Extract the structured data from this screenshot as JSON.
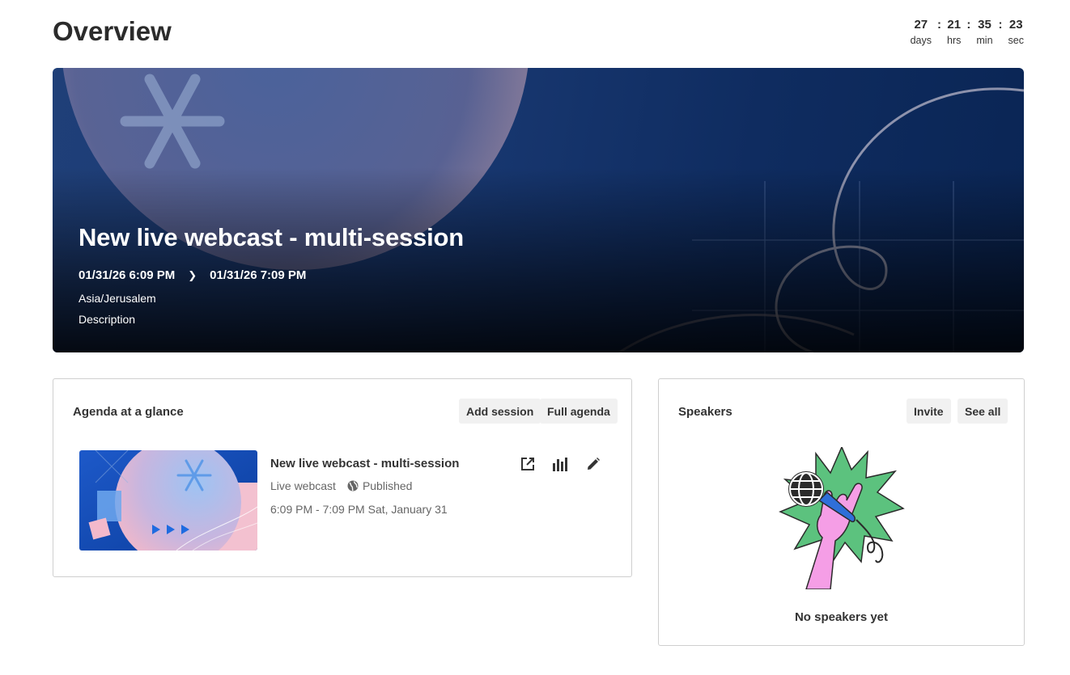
{
  "header": {
    "title": "Overview"
  },
  "countdown": {
    "days": "27",
    "hrs": "21",
    "min": "35",
    "sec": "23",
    "days_label": "days",
    "hrs_label": "hrs",
    "min_label": "min",
    "sec_label": "sec",
    "separator": ":"
  },
  "hero": {
    "title": "New live webcast - multi-session",
    "start": "01/31/26 6:09 PM",
    "end": "01/31/26 7:09 PM",
    "timezone": "Asia/Jerusalem",
    "description": "Description"
  },
  "agenda": {
    "title": "Agenda at a glance",
    "add_session_label": "Add session",
    "full_agenda_label": "Full agenda",
    "session": {
      "title": "New live webcast - multi-session",
      "type": "Live webcast",
      "status": "Published",
      "time": "6:09 PM - 7:09 PM Sat, January 31"
    }
  },
  "speakers": {
    "title": "Speakers",
    "invite_label": "Invite",
    "see_all_label": "See all",
    "empty_text": "No speakers yet"
  },
  "icons": {
    "open": "open-external-icon",
    "stats": "bar-chart-icon",
    "edit": "pencil-icon",
    "globe": "globe-icon",
    "chevron": "chevron-right-icon"
  },
  "colors": {
    "hero_bg": "#1a3a74",
    "button_bg": "#f1f1f1",
    "illus_green": "#5cc27e",
    "illus_pink": "#f59ee6",
    "illus_blue": "#2f6fd9"
  }
}
